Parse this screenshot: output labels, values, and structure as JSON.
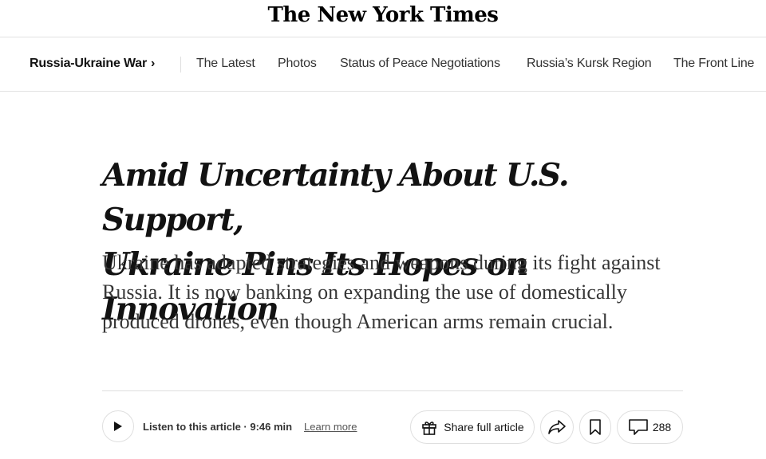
{
  "masthead": {
    "logo_text": "The New York Times"
  },
  "subnav": {
    "section_label": "Russia-Ukraine War",
    "section_chevron": "›",
    "items": [
      {
        "label": "The Latest"
      },
      {
        "label": "Photos"
      },
      {
        "label": "Status of Peace Negotiations"
      },
      {
        "label": "Russia’s Kursk Region"
      },
      {
        "label": "The Front Line"
      }
    ]
  },
  "article": {
    "headline_line1": "Amid Uncertainty About U.S. Support,",
    "headline_line2": "Ukraine Pins Its Hopes on Innovation",
    "summary": "Ukraine has adapted strategies and weapons during its fight against Russia. It is now banking on expanding the use of domestically produced drones, even though American arms remain crucial."
  },
  "toolbar": {
    "listen_label": "Listen to this article · 9:46 min",
    "learn_more": "Learn more",
    "share_full_label": "Share full article",
    "comment_count": "288"
  },
  "icons": {
    "play": "play-icon",
    "gift": "gift-icon",
    "share": "share-arrow-icon",
    "bookmark": "bookmark-icon",
    "comment": "comment-bubble-icon"
  },
  "colors": {
    "text": "#121212",
    "border": "#dfdfdf",
    "summary": "#363636"
  }
}
